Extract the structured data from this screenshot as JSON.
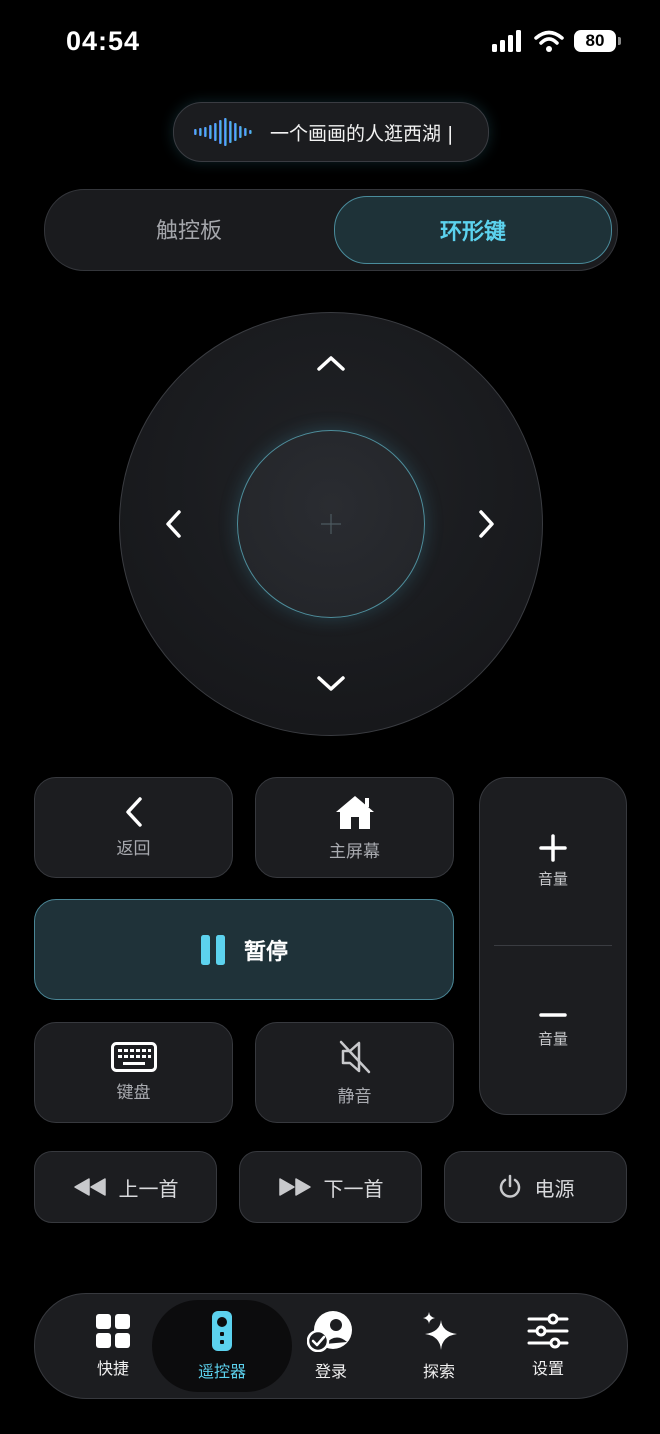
{
  "status_bar": {
    "time": "04:54",
    "battery": "80"
  },
  "voice": {
    "text": "一个画画的人逛西湖 |"
  },
  "mode_switch": {
    "left_label": "触控板",
    "right_label": "环形键",
    "selected": "环形键"
  },
  "controls": {
    "back_label": "返回",
    "home_label": "主屏幕",
    "pause_label": "暂停",
    "keyboard_label": "键盘",
    "mute_label": "静音",
    "volume_up_label": "音量",
    "volume_down_label": "音量",
    "prev_label": "上一首",
    "next_label": "下一首",
    "power_label": "电源"
  },
  "tabs": [
    {
      "label": "快捷",
      "icon": "grid-icon"
    },
    {
      "label": "遥控器",
      "icon": "remote-icon",
      "active": true
    },
    {
      "label": "登录",
      "icon": "user-check-icon"
    },
    {
      "label": "探索",
      "icon": "sparkle-icon"
    },
    {
      "label": "设置",
      "icon": "sliders-icon"
    }
  ],
  "colors": {
    "accent": "#5cd2ee",
    "background": "#000000",
    "surface": "#1c1d20"
  }
}
